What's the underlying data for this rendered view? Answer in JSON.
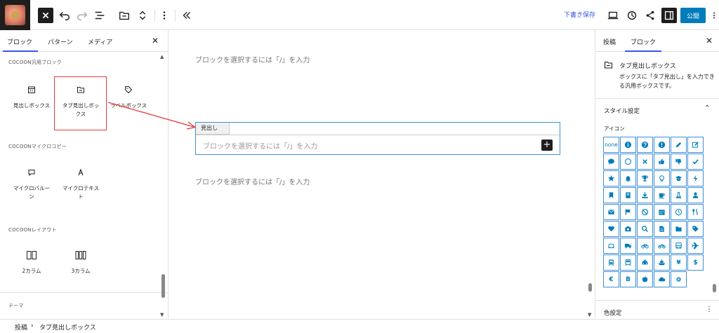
{
  "toolbar": {
    "draft_save": "下書き保存",
    "publish": "公開"
  },
  "inserter": {
    "tabs": [
      "ブロック",
      "パターン",
      "メディア"
    ],
    "categories": [
      {
        "title": "COCOON汎用ブロック",
        "blocks": [
          {
            "label": "見出しボックス",
            "icon": "calendar-icon"
          },
          {
            "label": "タブ見出しボックス",
            "icon": "folder-icon"
          },
          {
            "label": "ラベルボックス",
            "icon": "tag-icon"
          }
        ]
      },
      {
        "title": "COCOONマイクロコピー",
        "blocks": [
          {
            "label": "マイクロバルーン",
            "icon": "speech-balloon-icon"
          },
          {
            "label": "マイクロテキスト",
            "icon": "letter-a-icon"
          }
        ]
      },
      {
        "title": "COCOONレイアウト",
        "blocks": [
          {
            "label": "2カラム",
            "icon": "two-columns-icon"
          },
          {
            "label": "3カラム",
            "icon": "three-columns-icon"
          }
        ]
      },
      {
        "title": "テーマ",
        "blocks": []
      }
    ]
  },
  "editor": {
    "placeholder_top": "ブロックを選択するには「/」を入力",
    "heading_box": {
      "tab_label": "見出し",
      "placeholder": "ブロックを選択するには「/」を入力"
    },
    "placeholder_bottom": "ブロックを選択するには「/」を入力"
  },
  "settings": {
    "tabs": [
      "投稿",
      "ブロック"
    ],
    "block": {
      "title": "タブ見出しボックス",
      "description": "ボックスに「タブ見出し」を入力できる汎用ボックスです。"
    },
    "style_section": "スタイル設定",
    "icon_label": "アイコン",
    "icons": [
      "none",
      "info-icon",
      "question-icon",
      "exclamation-icon",
      "pencil-icon",
      "edit-icon",
      "comment-icon",
      "circle-icon",
      "close-icon",
      "thumbs-up-icon",
      "thumbs-down-icon",
      "check-icon",
      "star-icon",
      "bell-icon",
      "trophy-icon",
      "lightbulb-icon",
      "graduation-cap-icon",
      "bolt-icon",
      "bookmark-icon",
      "book-icon",
      "download-icon",
      "coffee-icon",
      "flask-icon",
      "user-icon",
      "envelope-icon",
      "flag-icon",
      "ban-icon",
      "calendar-icon",
      "clock-icon",
      "cutlery-icon",
      "heart-icon",
      "camera-icon",
      "search-icon",
      "file-icon",
      "folder-icon",
      "tag-icon",
      "car-icon",
      "truck-icon",
      "bicycle-icon",
      "motorcycle-icon",
      "bus-icon",
      "plane-icon",
      "train-icon",
      "subway-icon",
      "taxi-icon",
      "ship-icon",
      "yen-icon",
      "dollar-icon",
      "euro-icon",
      "bitcoin-icon",
      "apple-icon",
      "cloud-icon",
      "gear-icon"
    ],
    "glyphs": {
      "yen-icon": "¥",
      "dollar-icon": "$",
      "euro-icon": "€",
      "bitcoin-icon": "B",
      "none": "none"
    },
    "color_section": "色設定"
  },
  "breadcrumb": {
    "items": [
      "投稿",
      "タブ見出しボックス"
    ]
  },
  "colors": {
    "accent": "#3858e9",
    "publish": "#007cba",
    "highlight": "#e8383d",
    "icon": "#007cba"
  }
}
